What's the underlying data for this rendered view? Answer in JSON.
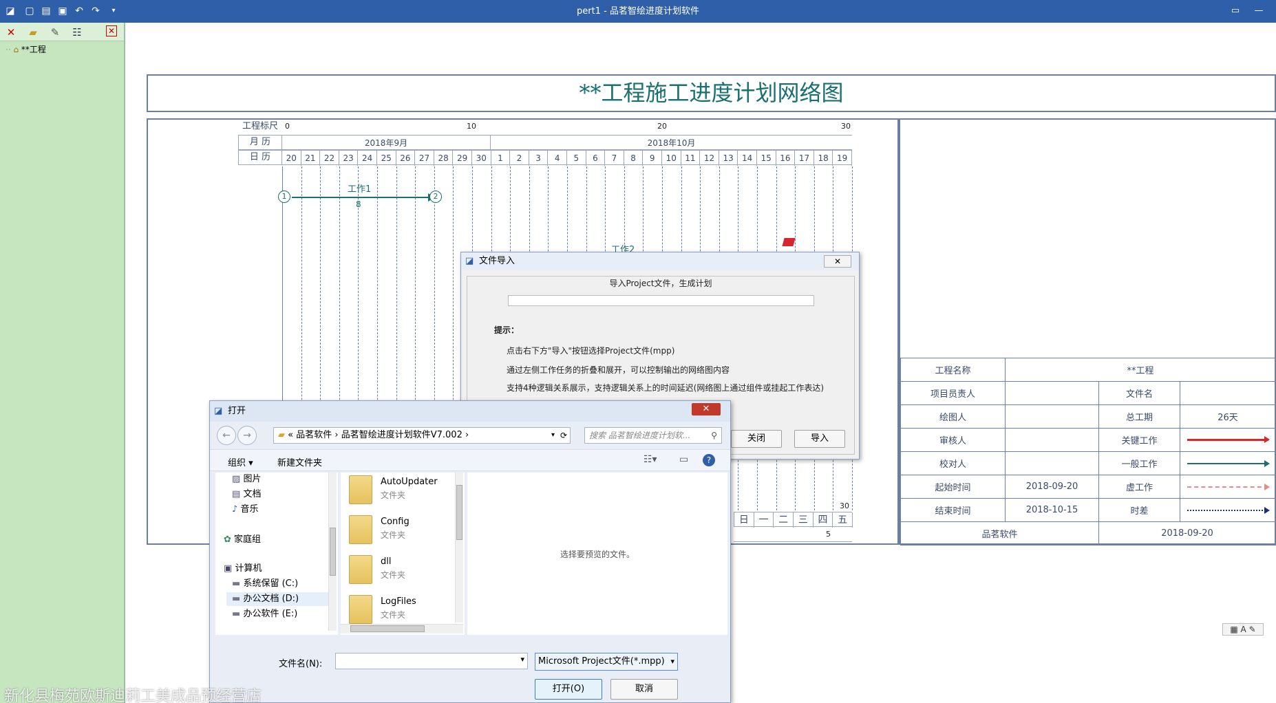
{
  "window": {
    "title": "pert1 - 品茗智绘进度计划软件"
  },
  "tree": {
    "root": "**工程"
  },
  "header": {
    "title": "**工程施工进度计划网络图"
  },
  "timeline": {
    "ruler_label": "工程标尺",
    "ruler_ticks": [
      "0",
      "10",
      "20",
      "30"
    ],
    "month_label": "月 历",
    "months": [
      "2018年9月",
      "2018年10月"
    ],
    "day_label": "日 历",
    "days": [
      "20",
      "21",
      "22",
      "23",
      "24",
      "25",
      "26",
      "27",
      "28",
      "29",
      "30",
      "1",
      "2",
      "3",
      "4",
      "5",
      "6",
      "7",
      "8",
      "9",
      "10",
      "11",
      "12",
      "13",
      "14",
      "15",
      "16",
      "17",
      "18",
      "19"
    ],
    "bottom_ruler_tick": "30",
    "bottom_weekdays": [
      "日",
      "一",
      "二",
      "三",
      "四",
      "五"
    ],
    "bottom_week_number": "5"
  },
  "network": {
    "node1": "1",
    "node2": "2",
    "task1_name": "工作1",
    "task1_duration": "8",
    "task2_name": "工作2"
  },
  "info_table": {
    "project_name_label": "工程名称",
    "project_name": "**工程",
    "pm_label": "项目员责人",
    "pm": "",
    "filename_label": "文件名",
    "filename": "",
    "drawer_label": "绘图人",
    "drawer": "",
    "duration_label": "总工期",
    "duration": "26天",
    "reviewer_label": "审核人",
    "reviewer": "",
    "critical_label": "关键工作",
    "checker_label": "校对人",
    "checker": "",
    "normal_label": "一般工作",
    "start_label": "起始时间",
    "start": "2018-09-20",
    "virtual_label": "虚工作",
    "end_label": "结束时间",
    "end": "2018-10-15",
    "float_label": "时差",
    "software": "品茗软件",
    "date": "2018-09-20"
  },
  "colors": {
    "critical": "#d7262e",
    "normal": "#1a6f6f",
    "virtual": "#e88a8a",
    "float": "#1a2f7a"
  },
  "import_dialog": {
    "title": "文件导入",
    "group_label": "导入Project文件，生成计划",
    "tip_title": "提示：",
    "tip1": "点击右下方\"导入\"按钮选择Project文件(mpp)",
    "tip2": "通过左侧工作任务的折叠和展开，可以控制输出的网络图内容",
    "tip3": "支持4种逻辑关系展示，支持逻辑关系上的时间延迟(网络图上通过组件或挂起工作表达)",
    "close": "关闭",
    "import": "导入"
  },
  "open_dialog": {
    "title": "打开",
    "path_prefix": "«",
    "path1": "品茗软件",
    "path2": "品茗智绘进度计划软件V7.002",
    "search_placeholder": "搜索 品茗智绘进度计划软...",
    "organize": "组织 ▾",
    "new_folder": "新建文件夹",
    "nav": [
      "图片",
      "文档",
      "音乐",
      "家庭组",
      "计算机",
      "系统保留 (C:)",
      "办公文档 (D:)",
      "办公软件 (E:)"
    ],
    "files": [
      {
        "name": "AutoUpdater",
        "type": "文件夹"
      },
      {
        "name": "Config",
        "type": "文件夹"
      },
      {
        "name": "dll",
        "type": "文件夹"
      },
      {
        "name": "LogFiles",
        "type": "文件夹"
      }
    ],
    "preview": "选择要预览的文件。",
    "filename_label": "文件名(N):",
    "filter": "Microsoft Project文件(*.mpp)",
    "open": "打开(O)",
    "cancel": "取消"
  },
  "watermark": "新化县梅苑欧斯迪莉工美成品预经营店"
}
